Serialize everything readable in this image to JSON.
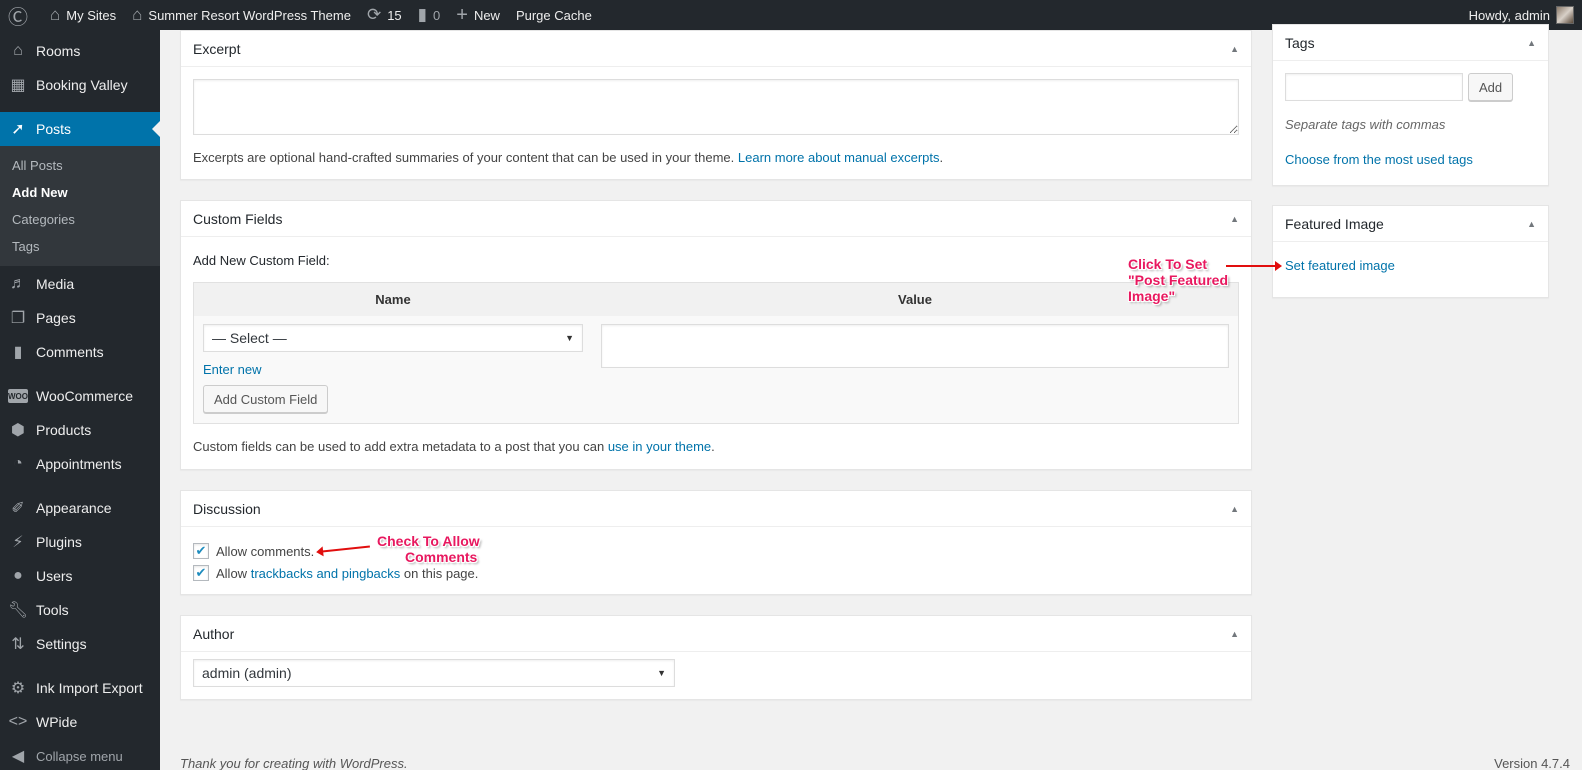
{
  "adminbar": {
    "wp_logo": "wordpress-logo",
    "my_sites": "My Sites",
    "site_name": "Summer Resort WordPress Theme",
    "updates_count": "15",
    "comments_count": "0",
    "new_label": "New",
    "purge_cache": "Purge Cache",
    "greeting": "Howdy, admin"
  },
  "sidebar": {
    "items_top": [
      {
        "label": "Rooms",
        "icon": "home-icon"
      },
      {
        "label": "Booking Valley",
        "icon": "calendar-icon"
      }
    ],
    "posts": {
      "label": "Posts",
      "icon": "pin-icon",
      "submenu": [
        "All Posts",
        "Add New",
        "Categories",
        "Tags"
      ],
      "current": "Add New"
    },
    "items_mid": [
      {
        "label": "Media",
        "icon": "media-icon"
      },
      {
        "label": "Pages",
        "icon": "pages-icon"
      },
      {
        "label": "Comments",
        "icon": "comment-icon"
      }
    ],
    "items_woo": [
      {
        "label": "WooCommerce",
        "icon": "woocommerce-icon"
      },
      {
        "label": "Products",
        "icon": "box-icon"
      },
      {
        "label": "Appointments",
        "icon": "appointments-icon"
      }
    ],
    "items_admin": [
      {
        "label": "Appearance",
        "icon": "paintbrush-icon"
      },
      {
        "label": "Plugins",
        "icon": "plug-icon"
      },
      {
        "label": "Users",
        "icon": "user-icon"
      },
      {
        "label": "Tools",
        "icon": "wrench-icon"
      },
      {
        "label": "Settings",
        "icon": "sliders-icon"
      }
    ],
    "items_extra": [
      {
        "label": "Ink Import Export",
        "icon": "gear-icon"
      },
      {
        "label": "WPide",
        "icon": "code-icon"
      }
    ],
    "collapse": "Collapse menu"
  },
  "excerpt": {
    "title": "Excerpt",
    "value": "",
    "help_text": "Excerpts are optional hand-crafted summaries of your content that can be used in your theme.",
    "help_link": "Learn more about manual excerpts",
    "help_end": "."
  },
  "custom_fields": {
    "title": "Custom Fields",
    "add_new_label": "Add New Custom Field:",
    "col_name": "Name",
    "col_value": "Value",
    "select_value": "— Select —",
    "enter_new": "Enter new",
    "add_button": "Add Custom Field",
    "help_text": "Custom fields can be used to add extra metadata to a post that you can",
    "help_link": "use in your theme",
    "help_end": "."
  },
  "discussion": {
    "title": "Discussion",
    "allow_comments": "Allow comments.",
    "allow_comments_checked": true,
    "allow_prefix": "Allow",
    "trackbacks_link": "trackbacks and pingbacks",
    "trackbacks_suffix": "on this page.",
    "allow_trackbacks_checked": true
  },
  "author": {
    "title": "Author",
    "selected": "admin (admin)"
  },
  "tags": {
    "title": "Tags",
    "input_value": "",
    "add_button": "Add",
    "howto": "Separate tags with commas",
    "choose_link": "Choose from the most used tags"
  },
  "featured_image": {
    "title": "Featured Image",
    "link": "Set featured image"
  },
  "annotations": {
    "featured": [
      "Click To Set",
      "\"Post Featured",
      "Image\""
    ],
    "comments": [
      "Check To Allow",
      "Comments"
    ]
  },
  "footer": {
    "left": "Thank you for creating with WordPress.",
    "right": "Version 4.7.4"
  },
  "colors": {
    "adminbar_bg": "#23282d",
    "active_menu": "#0073aa",
    "link": "#0073aa",
    "annotation": "#e8185f"
  }
}
